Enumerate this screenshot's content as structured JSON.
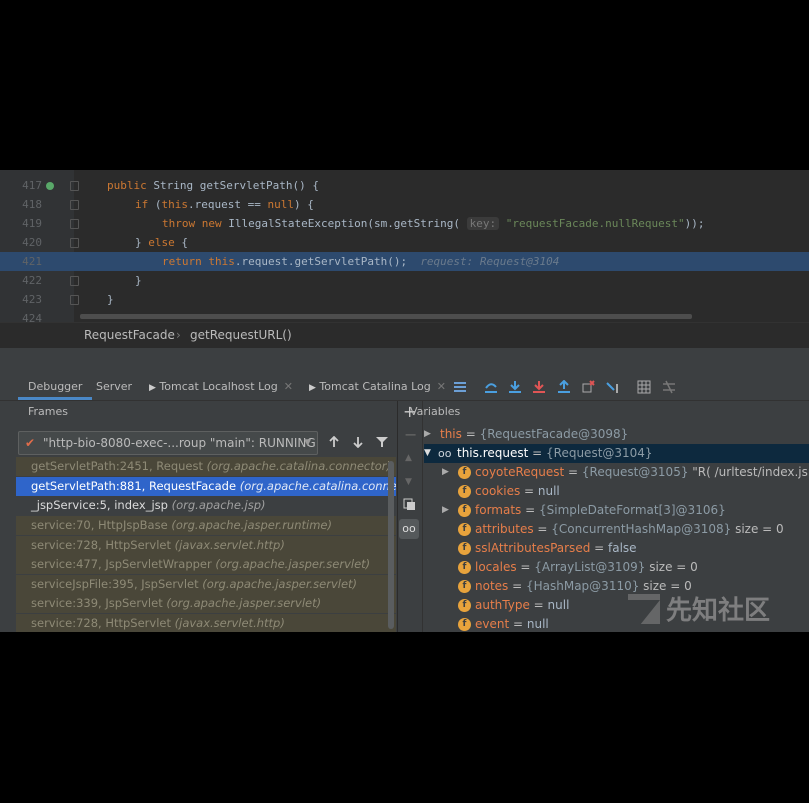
{
  "editor": {
    "lines": [
      {
        "num": "417"
      },
      {
        "num": "418"
      },
      {
        "num": "419"
      },
      {
        "num": "420"
      },
      {
        "num": "421"
      },
      {
        "num": "422"
      },
      {
        "num": "423"
      },
      {
        "num": "424"
      }
    ],
    "code": {
      "l417_kw": "public",
      "l417_rest": " String getServletPath() {",
      "l418_kw": "if",
      "l418_open": " (",
      "l418_this": "this",
      "l418_mid": ".request == ",
      "l418_null": "null",
      "l418_close": ") {",
      "l419_kw1": "throw",
      "l419_kw2": "new",
      "l419_call": " IllegalStateException(sm.getString(",
      "l419_param": "key:",
      "l419_str": "\"requestFacade.nullRequest\"",
      "l419_end": "));",
      "l420_close": "} ",
      "l420_kw": "else",
      "l420_open": " {",
      "l421_kw": "return",
      "l421_this": "this",
      "l421_rest": ".request.getServletPath();",
      "l421_inline": "request: Request@3104",
      "l422": "}",
      "l423": "}"
    }
  },
  "breadcrumb": {
    "class": "RequestFacade",
    "sep": "›",
    "method": "getRequestURL()"
  },
  "tabs": [
    {
      "label": "Debugger"
    },
    {
      "label": "Server"
    },
    {
      "label": "Tomcat Localhost Log"
    },
    {
      "label": "Tomcat Catalina Log"
    }
  ],
  "frames": {
    "header": "Frames",
    "thread": "\"http-bio-8080-exec-...roup \"main\": RUNNING",
    "items": [
      {
        "fn": "getServletPath:2451, Request",
        "pkg": "(org.apache.catalina.connector)"
      },
      {
        "fn": "getServletPath:881, RequestFacade",
        "pkg": "(org.apache.catalina.connector)"
      },
      {
        "fn": "_jspService:5, index_jsp",
        "pkg": "(org.apache.jsp)"
      },
      {
        "fn": "service:70, HttpJspBase",
        "pkg": "(org.apache.jasper.runtime)"
      },
      {
        "fn": "service:728, HttpServlet",
        "pkg": "(javax.servlet.http)"
      },
      {
        "fn": "service:477, JspServletWrapper",
        "pkg": "(org.apache.jasper.servlet)"
      },
      {
        "fn": "serviceJspFile:395, JspServlet",
        "pkg": "(org.apache.jasper.servlet)"
      },
      {
        "fn": "service:339, JspServlet",
        "pkg": "(org.apache.jasper.servlet)"
      },
      {
        "fn": "service:728, HttpServlet",
        "pkg": "(javax.servlet.http)"
      }
    ]
  },
  "variables": {
    "header": "Variables",
    "items": [
      {
        "name": "this",
        "eq": " = ",
        "val": "{RequestFacade@3098}"
      },
      {
        "name": "this.request",
        "eq": " = ",
        "val": "{Request@3104}"
      },
      {
        "name": "coyoteRequest",
        "eq": " = ",
        "val": "{Request@3105}",
        "extra": " \"R( /urltest/index.jsp)\""
      },
      {
        "name": "cookies",
        "eq": " = ",
        "val": "null"
      },
      {
        "name": "formats",
        "eq": " = ",
        "val": "{SimpleDateFormat[3]@3106}"
      },
      {
        "name": "attributes",
        "eq": " = ",
        "val": "{ConcurrentHashMap@3108}",
        "extra": "  size = 0"
      },
      {
        "name": "sslAttributesParsed",
        "eq": " = ",
        "val": "false"
      },
      {
        "name": "locales",
        "eq": " = ",
        "val": "{ArrayList@3109}",
        "extra": "  size = 0"
      },
      {
        "name": "notes",
        "eq": " = ",
        "val": "{HashMap@3110}",
        "extra": "  size = 0"
      },
      {
        "name": "authType",
        "eq": " = ",
        "val": "null"
      },
      {
        "name": "event",
        "eq": " = ",
        "val": "null"
      }
    ]
  },
  "watermark": "先知社区",
  "icons": [
    "override-icon",
    "fold-icon",
    "chevron-right-icon",
    "close-icon",
    "tomcat-icon",
    "menu-icon",
    "step-over-icon",
    "step-into-icon",
    "force-step-into-icon",
    "step-out-icon",
    "drop-frame-icon",
    "run-to-cursor-icon",
    "evaluate-icon",
    "trace-icon",
    "check-icon",
    "arrow-up-icon",
    "arrow-down-icon",
    "filter-icon",
    "plus-icon",
    "minus-icon",
    "copy-icon",
    "watch-icon",
    "field-icon",
    "expand-icon"
  ]
}
